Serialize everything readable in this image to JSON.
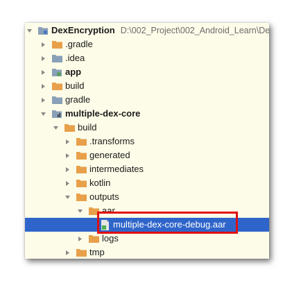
{
  "tree": {
    "root": {
      "label": "DexEncryption",
      "path": "D:\\002_Project\\002_Android_Learn\\De"
    },
    "items": [
      {
        "label": ".gradle"
      },
      {
        "label": ".idea"
      },
      {
        "label": "app"
      },
      {
        "label": "build"
      },
      {
        "label": "gradle"
      },
      {
        "label": "multiple-dex-core"
      },
      {
        "label": "build"
      },
      {
        "label": ".transforms"
      },
      {
        "label": "generated"
      },
      {
        "label": "intermediates"
      },
      {
        "label": "kotlin"
      },
      {
        "label": "outputs"
      },
      {
        "label": "aar"
      },
      {
        "label": "multiple-dex-core-debug.aar"
      },
      {
        "label": "logs"
      },
      {
        "label": "tmp"
      }
    ]
  },
  "colors": {
    "panel_background": "#fdfce8",
    "selection": "#2f65ca",
    "folder": "#e8a04a",
    "highlight_border": "#e01010"
  },
  "icons": {
    "expanded": "chevron-down-icon",
    "collapsed": "chevron-right-icon",
    "folder": "folder-icon",
    "module": "module-folder-icon",
    "aar_file": "aar-file-icon"
  }
}
